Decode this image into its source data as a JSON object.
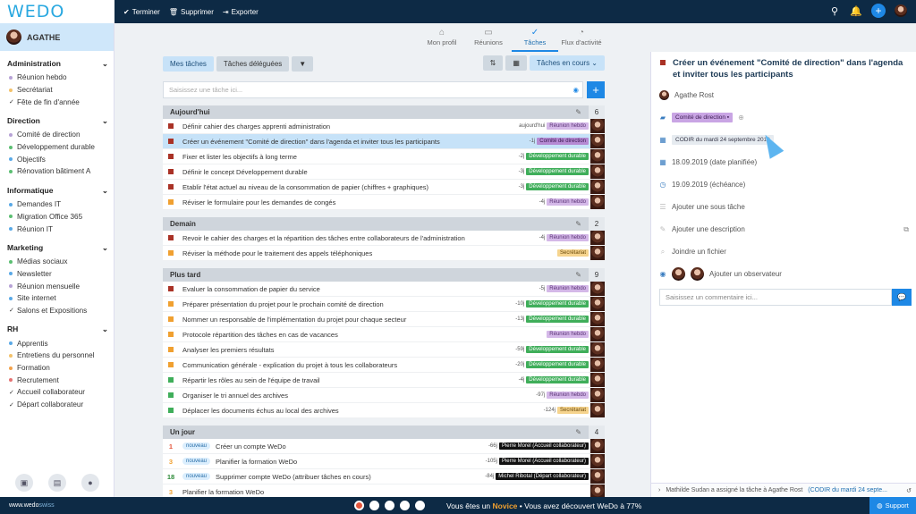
{
  "app": {
    "logo": "WEDO",
    "user": "AGATHE"
  },
  "topbar": {
    "terminer": "Terminer",
    "supprimer": "Supprimer",
    "exporter": "Exporter"
  },
  "sidebar": {
    "groups": [
      {
        "title": "Administration",
        "items": [
          {
            "label": "Réunion hebdo",
            "color": "#b7a3d6",
            "type": "dot"
          },
          {
            "label": "Secrétariat",
            "color": "#f3c26b",
            "type": "dot"
          },
          {
            "label": "Fête de fin d'année",
            "color": "#333",
            "type": "check"
          }
        ]
      },
      {
        "title": "Direction",
        "items": [
          {
            "label": "Comité de direction",
            "color": "#b7a3d6",
            "type": "dot"
          },
          {
            "label": "Développement durable",
            "color": "#5bbf72",
            "type": "dot"
          },
          {
            "label": "Objectifs",
            "color": "#5aa9e6",
            "type": "dot"
          },
          {
            "label": "Rénovation bâtiment A",
            "color": "#5bbf72",
            "type": "dot"
          }
        ]
      },
      {
        "title": "Informatique",
        "items": [
          {
            "label": "Demandes IT",
            "color": "#5aa9e6",
            "type": "dot"
          },
          {
            "label": "Migration Office 365",
            "color": "#5bbf72",
            "type": "dot"
          },
          {
            "label": "Réunion IT",
            "color": "#5aa9e6",
            "type": "dot"
          }
        ]
      },
      {
        "title": "Marketing",
        "items": [
          {
            "label": "Médias sociaux",
            "color": "#5bbf72",
            "type": "dot"
          },
          {
            "label": "Newsletter",
            "color": "#5aa9e6",
            "type": "dot"
          },
          {
            "label": "Réunion mensuelle",
            "color": "#b7a3d6",
            "type": "dot"
          },
          {
            "label": "Site internet",
            "color": "#5aa9e6",
            "type": "dot"
          },
          {
            "label": "Salons et Expositions",
            "color": "#333",
            "type": "check"
          }
        ]
      },
      {
        "title": "RH",
        "items": [
          {
            "label": "Apprentis",
            "color": "#5aa9e6",
            "type": "dot"
          },
          {
            "label": "Entretiens du personnel",
            "color": "#f3c26b",
            "type": "dot"
          },
          {
            "label": "Formation",
            "color": "#f3a24b",
            "type": "dot"
          },
          {
            "label": "Recrutement",
            "color": "#e57373",
            "type": "dot"
          },
          {
            "label": "Accueil collaborateur",
            "color": "#333",
            "type": "check"
          },
          {
            "label": "Départ collaborateur",
            "color": "#333",
            "type": "check"
          }
        ]
      }
    ]
  },
  "tabs": [
    {
      "label": "Mon profil",
      "icon": "⌂"
    },
    {
      "label": "Réunions",
      "icon": "▭"
    },
    {
      "label": "Tâches",
      "icon": "✓",
      "active": true
    },
    {
      "label": "Flux d'activité",
      "icon": "◔"
    }
  ],
  "toolbar": {
    "mes_taches": "Mes tâches",
    "taches_deleguees": "Tâches déléguées",
    "filter_status": "Tâches en cours"
  },
  "search": {
    "placeholder": "Saisissez une tâche ici..."
  },
  "sections": [
    {
      "title": "Aujourd'hui",
      "count": "6",
      "rows": [
        {
          "text": "Définir cahier des charges apprenti administration",
          "meta": "aujourd'hui",
          "tag": "Réunion hebdo",
          "tagbg": "#d4b8e8",
          "tagfg": "#5a3275",
          "sq": "#a93226",
          "hl": false
        },
        {
          "text": "Créer un événement \"Comité de direction\" dans l'agenda et inviter tous les participants",
          "meta": "-1j",
          "tag": "Comité de direction",
          "tagbg": "#b58ad3",
          "tagfg": "#3b1a52",
          "sq": "#a93226",
          "hl": true
        },
        {
          "text": "Fixer et lister les objectifs à long terme",
          "meta": "-2j",
          "tag": "Développement durable",
          "tagbg": "#3fae5a",
          "tagfg": "#fff",
          "sq": "#a93226",
          "hl": false
        },
        {
          "text": "Définir le concept Développement durable",
          "meta": "-3j",
          "tag": "Développement durable",
          "tagbg": "#3fae5a",
          "tagfg": "#fff",
          "sq": "#a93226",
          "hl": false
        },
        {
          "text": "Etablir l'état actuel au niveau de la consommation de papier (chiffres + graphiques)",
          "meta": "-3j",
          "tag": "Développement durable",
          "tagbg": "#3fae5a",
          "tagfg": "#fff",
          "sq": "#a93226",
          "hl": false
        },
        {
          "text": "Réviser le formulaire pour les demandes de congés",
          "meta": "-4j",
          "tag": "Réunion hebdo",
          "tagbg": "#d4b8e8",
          "tagfg": "#5a3275",
          "sq": "#f0a030",
          "hl": false
        }
      ]
    },
    {
      "title": "Demain",
      "count": "2",
      "rows": [
        {
          "text": "Revoir le cahier des charges et la répartition des tâches entre collaborateurs de l'administration",
          "meta": "-4j",
          "tag": "Réunion hebdo",
          "tagbg": "#d4b8e8",
          "tagfg": "#5a3275",
          "sq": "#a93226",
          "hl": false
        },
        {
          "text": "Réviser la méthode pour le traitement des appels téléphoniques",
          "meta": "",
          "tag": "Secrétariat",
          "tagbg": "#f6d48e",
          "tagfg": "#6b4a0a",
          "sq": "#f0a030",
          "hl": false
        }
      ]
    },
    {
      "title": "Plus tard",
      "count": "9",
      "rows": [
        {
          "text": "Evaluer la consommation de papier du service",
          "meta": "-5j",
          "tag": "Réunion hebdo",
          "tagbg": "#d4b8e8",
          "tagfg": "#5a3275",
          "sq": "#a93226",
          "hl": false
        },
        {
          "text": "Préparer présentation du projet pour le prochain comité de direction",
          "meta": "-10j",
          "tag": "Développement durable",
          "tagbg": "#3fae5a",
          "tagfg": "#fff",
          "sq": "#f0a030",
          "hl": false
        },
        {
          "text": "Nommer un responsable de l'implémentation du projet pour chaque secteur",
          "meta": "-13j",
          "tag": "Développement durable",
          "tagbg": "#3fae5a",
          "tagfg": "#fff",
          "sq": "#f0a030",
          "hl": false
        },
        {
          "text": "Protocole répartition des tâches en cas de vacances",
          "meta": "",
          "tag": "Réunion hebdo",
          "tagbg": "#d4b8e8",
          "tagfg": "#5a3275",
          "sq": "#f0a030",
          "hl": false
        },
        {
          "text": "Analyser les premiers résultats",
          "meta": "-59j",
          "tag": "Développement durable",
          "tagbg": "#3fae5a",
          "tagfg": "#fff",
          "sq": "#f0a030",
          "hl": false
        },
        {
          "text": "Communication générale - explication du projet à tous les collaborateurs",
          "meta": "-20j",
          "tag": "Développement durable",
          "tagbg": "#3fae5a",
          "tagfg": "#fff",
          "sq": "#f0a030",
          "hl": false
        },
        {
          "text": "Répartir les rôles au sein de l'équipe de travail",
          "meta": "-4j",
          "tag": "Développement durable",
          "tagbg": "#3fae5a",
          "tagfg": "#fff",
          "sq": "#3fae5a",
          "hl": false
        },
        {
          "text": "Organiser le tri annuel des archives",
          "meta": "-97j",
          "tag": "Réunion hebdo",
          "tagbg": "#d4b8e8",
          "tagfg": "#5a3275",
          "sq": "#3fae5a",
          "hl": false
        },
        {
          "text": "Déplacer les documents échus au local des archives",
          "meta": "-124j",
          "tag": "Secrétariat",
          "tagbg": "#f6d48e",
          "tagfg": "#6b4a0a",
          "sq": "#3fae5a",
          "hl": false
        }
      ]
    },
    {
      "title": "Un jour",
      "count": "4",
      "rows": [
        {
          "num": "1",
          "numcolor": "#e4573d",
          "nouveau": "nouveau",
          "text": "Créer un compte WeDo",
          "meta": "-66j",
          "tag": "Pierre Morel (Accueil collaborateur)",
          "tagbg": "#111",
          "tagfg": "#fff",
          "hl": false
        },
        {
          "num": "3",
          "numcolor": "#f0a030",
          "nouveau": "nouveau",
          "text": "Planifier la formation WeDo",
          "meta": "-105j",
          "tag": "Pierre Morel (Accueil collaborateur)",
          "tagbg": "#111",
          "tagfg": "#fff",
          "hl": false
        },
        {
          "num": "18",
          "numcolor": "#2e8b3a",
          "nouveau": "nouveau",
          "text": "Supprimer compte WeDo (attribuer tâches en cours)",
          "meta": "-84j",
          "tag": "Michel Ribotal (Départ collaborateur)",
          "tagbg": "#111",
          "tagfg": "#fff",
          "hl": false
        },
        {
          "num": "3",
          "numcolor": "#f0a030",
          "nouveau": "",
          "text": "Planifier la formation WeDo",
          "meta": "",
          "tag": "",
          "tagbg": "#111",
          "tagfg": "#fff",
          "hl": false
        }
      ]
    }
  ],
  "detail": {
    "title": "Créer un événement \"Comité de direction\" dans l'agenda et inviter tous les participants",
    "assignee": "Agathe Rost",
    "tag": "Comité de direction",
    "meeting": "CODIR du mardi 24 septembre 2019",
    "planned": "18.09.2019 (date planifiée)",
    "due": "19.09.2019 (échéance)",
    "subtask": "Ajouter une sous tâche",
    "description": "Ajouter une description",
    "attach": "Joindre un fichier",
    "observer": "Ajouter un observateur",
    "comment_placeholder": "Saisissez un commentaire ici...",
    "activity": "Mathilde Sudan a assigné la tâche à Agathe Rost",
    "activity_link": "(CODIR du mardi 24 septe..."
  },
  "bottom": {
    "site": "www.wedo",
    "site_suffix": "swiss",
    "msg_a": "Vous êtes un",
    "level": "Novice",
    "msg_b": "• Vous avez découvert WeDo à 77%",
    "progress": 0.77,
    "support": "Support"
  }
}
